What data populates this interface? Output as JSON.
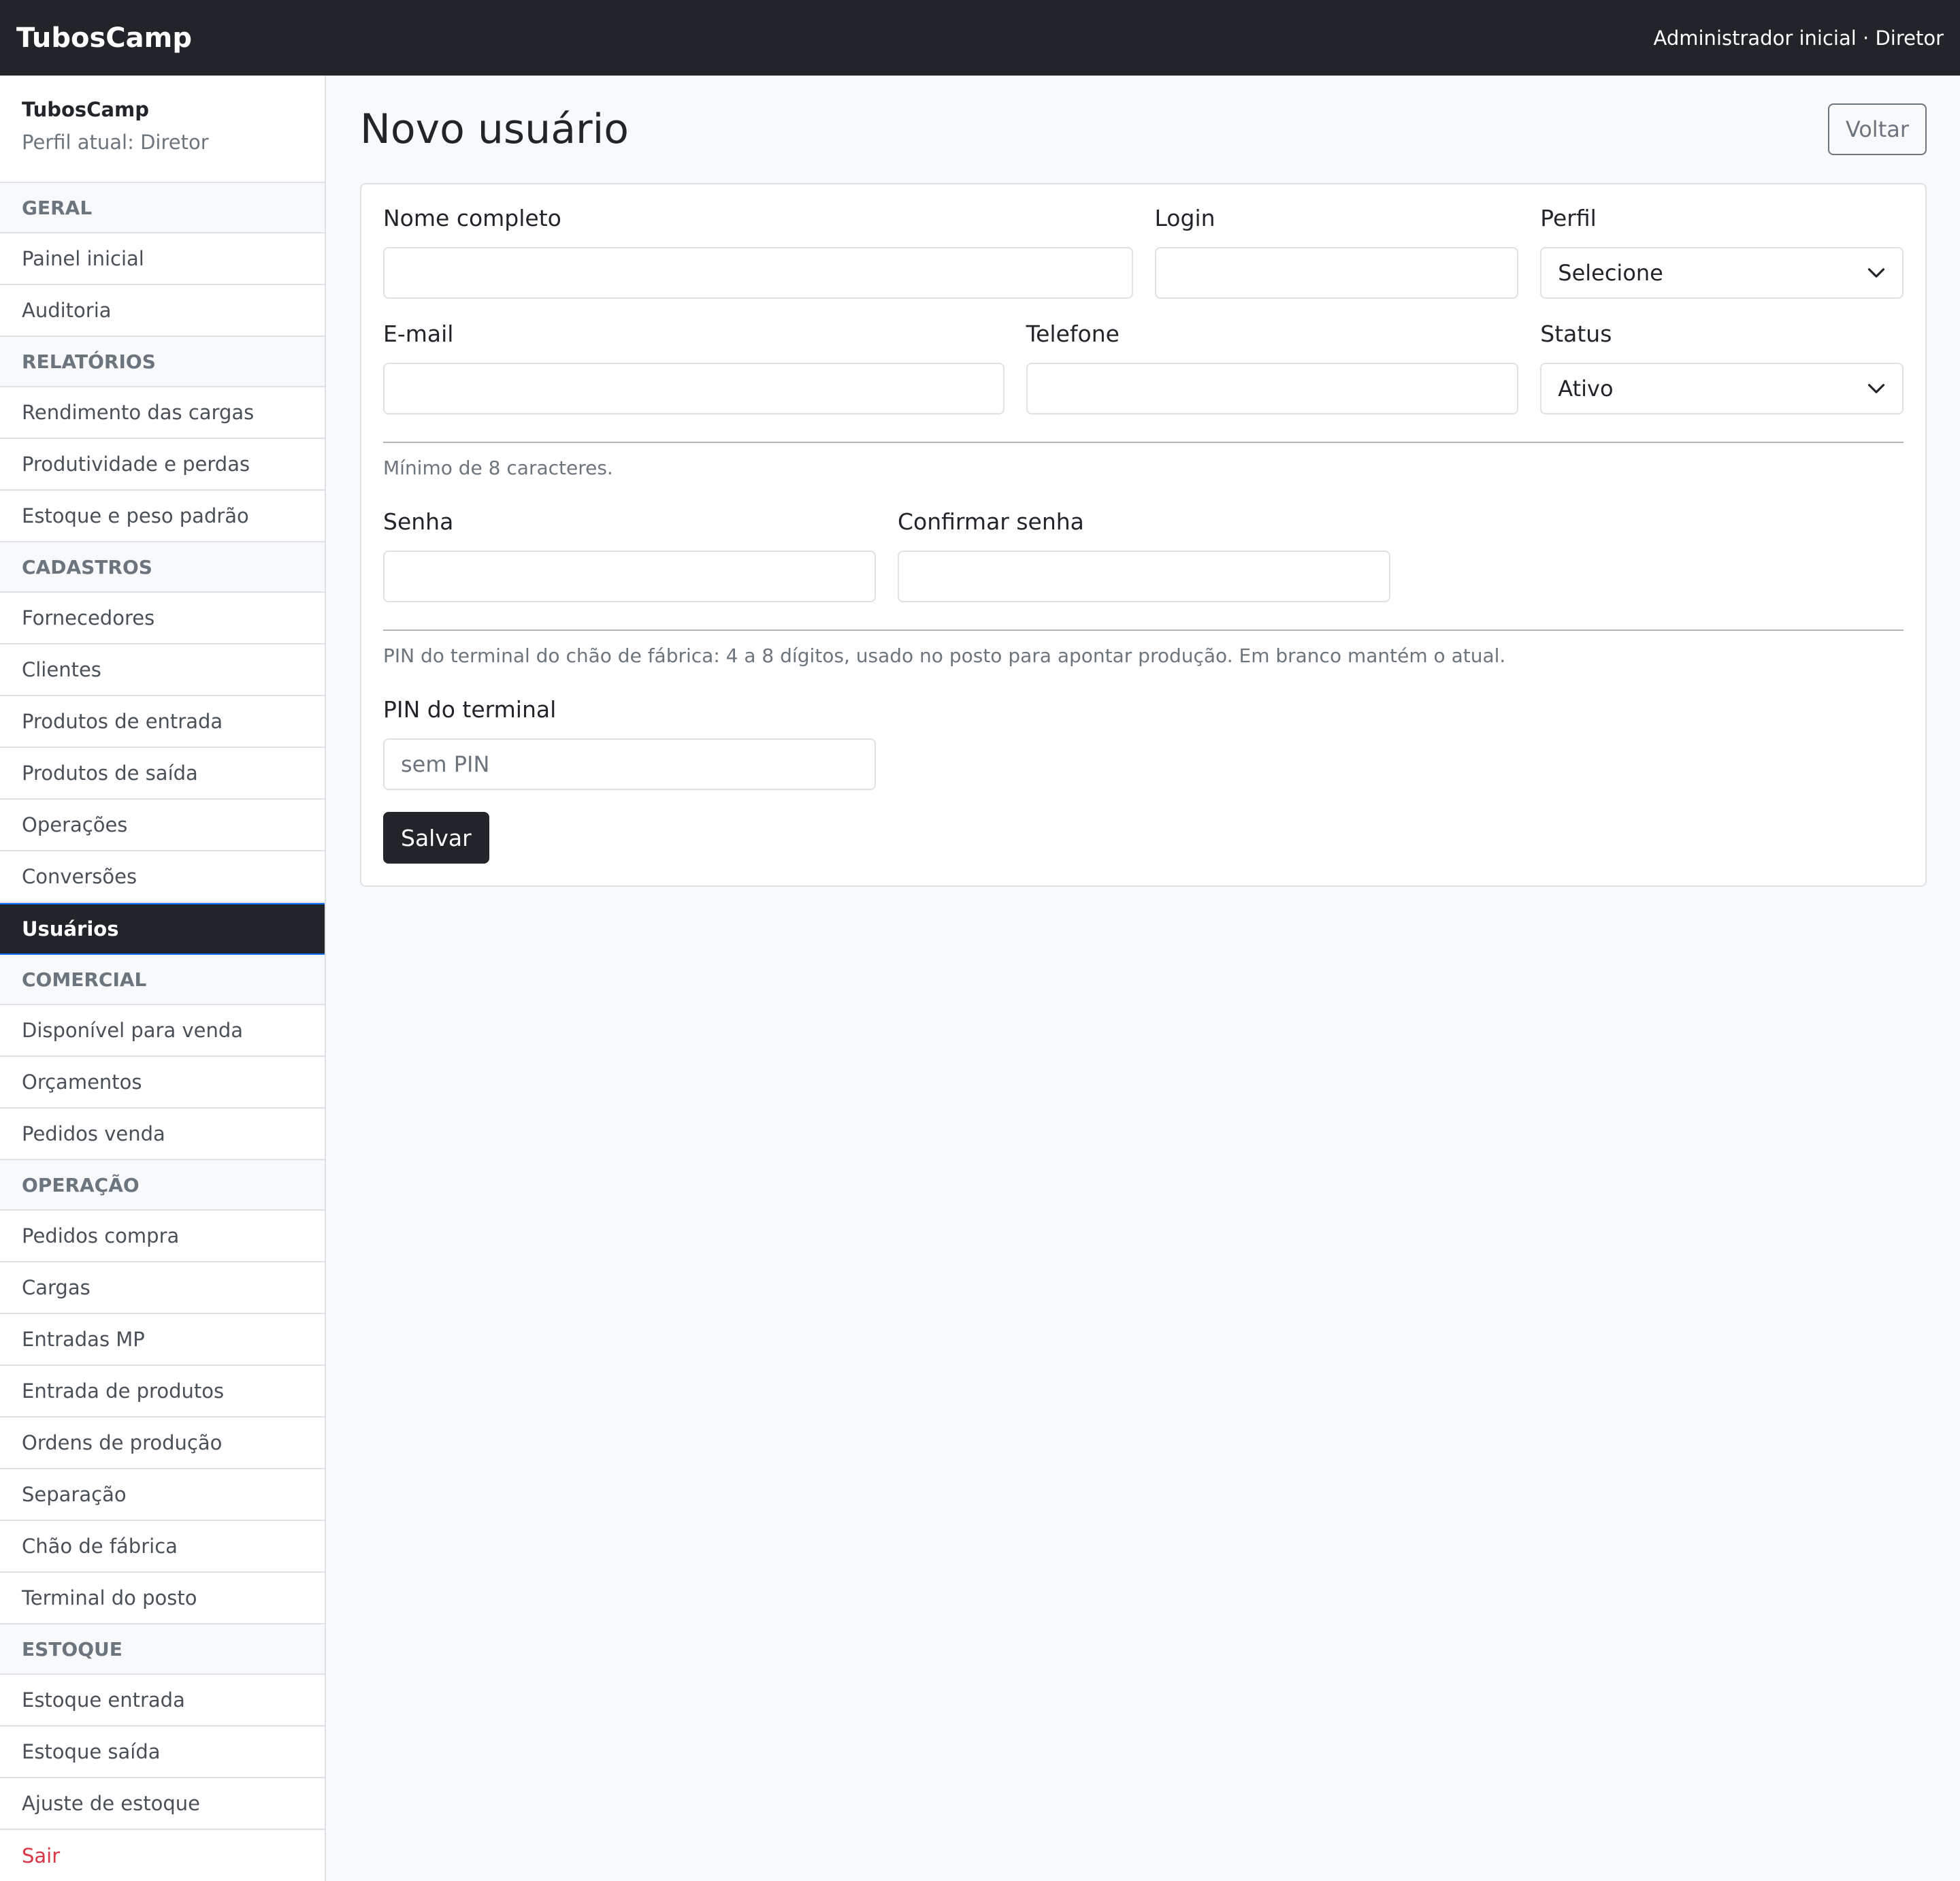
{
  "topbar": {
    "brand": "TubosCamp",
    "user": "Administrador inicial · Diretor"
  },
  "sidebar": {
    "app_name": "TubosCamp",
    "profile": "Perfil atual: Diretor",
    "sections": {
      "geral": "GERAL",
      "relatorios": "RELATÓRIOS",
      "cadastros": "CADASTROS",
      "comercial": "COMERCIAL",
      "operacao": "OPERAÇÃO",
      "estoque": "ESTOQUE"
    },
    "items": {
      "painel": "Painel inicial",
      "auditoria": "Auditoria",
      "rendimento": "Rendimento das cargas",
      "produtividade": "Produtividade e perdas",
      "estoque_peso": "Estoque e peso padrão",
      "fornecedores": "Fornecedores",
      "clientes": "Clientes",
      "produtos_entrada": "Produtos de entrada",
      "produtos_saida": "Produtos de saída",
      "operacoes": "Operações",
      "conversoes": "Conversões",
      "usuarios": "Usuários",
      "disponivel": "Disponível para venda",
      "orcamentos": "Orçamentos",
      "pedidos_venda": "Pedidos venda",
      "pedidos_compra": "Pedidos compra",
      "cargas": "Cargas",
      "entradas_mp": "Entradas MP",
      "entrada_produtos": "Entrada de produtos",
      "ordens_producao": "Ordens de produção",
      "separacao": "Separação",
      "chao_fabrica": "Chão de fábrica",
      "terminal_posto": "Terminal do posto",
      "estoque_entrada": "Estoque entrada",
      "estoque_saida": "Estoque saída",
      "ajuste_estoque": "Ajuste de estoque",
      "sair": "Sair"
    }
  },
  "page": {
    "title": "Novo usuário",
    "back_label": "Voltar"
  },
  "form": {
    "nome_label": "Nome completo",
    "nome_value": "",
    "login_label": "Login",
    "login_value": "",
    "perfil_label": "Perfil",
    "perfil_value": "Selecione",
    "email_label": "E-mail",
    "email_value": "",
    "telefone_label": "Telefone",
    "telefone_value": "",
    "status_label": "Status",
    "status_value": "Ativo",
    "senha_hint": "Mínimo de 8 caracteres.",
    "senha_label": "Senha",
    "senha_value": "",
    "confirmar_label": "Confirmar senha",
    "confirmar_value": "",
    "pin_hint": "PIN do terminal do chão de fábrica: 4 a 8 dígitos, usado no posto para apontar produção. Em branco mantém o atual.",
    "pin_label": "PIN do terminal",
    "pin_placeholder": "sem PIN",
    "pin_value": "",
    "save_label": "Salvar"
  },
  "colors": {
    "topbar_bg": "#212529",
    "active_item_bg": "#212529",
    "active_item_border": "#0d6efd",
    "logout_color": "#dc3545",
    "muted_text": "#6c757d",
    "page_bg": "#f8f9fa"
  }
}
